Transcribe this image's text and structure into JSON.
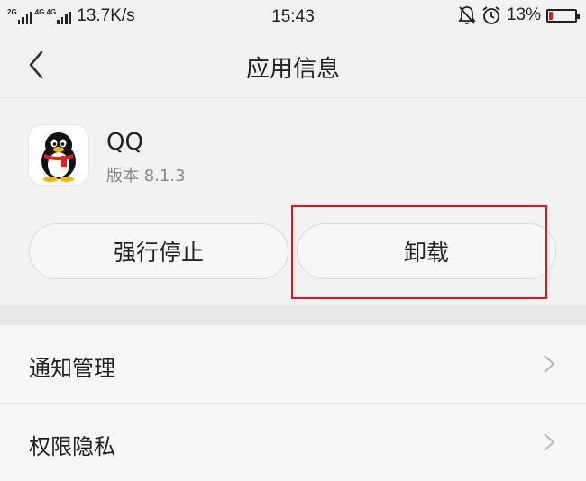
{
  "status_bar": {
    "network_1": "2G",
    "network_2": "4G 4G",
    "speed": "13.7K/s",
    "time": "15:43",
    "battery_text": "13%",
    "battery_level": 0.13,
    "icons": [
      "signal-icon",
      "mute-bell-icon",
      "alarm-clock-icon",
      "battery-icon"
    ]
  },
  "header": {
    "title": "应用信息",
    "back_icon": "back-chevron-icon"
  },
  "app": {
    "name": "QQ",
    "version": "版本 8.1.3",
    "icon": "qq-penguin-icon"
  },
  "actions": {
    "force_stop": "强行停止",
    "uninstall": "卸载"
  },
  "settings": {
    "items": [
      {
        "label": "通知管理",
        "icon": "chevron-right-icon"
      },
      {
        "label": "权限隐私",
        "icon": "chevron-right-icon"
      }
    ]
  },
  "colors": {
    "background": "#f2f2f2",
    "highlight": "#e0141e",
    "battery_low": "#e02020"
  }
}
